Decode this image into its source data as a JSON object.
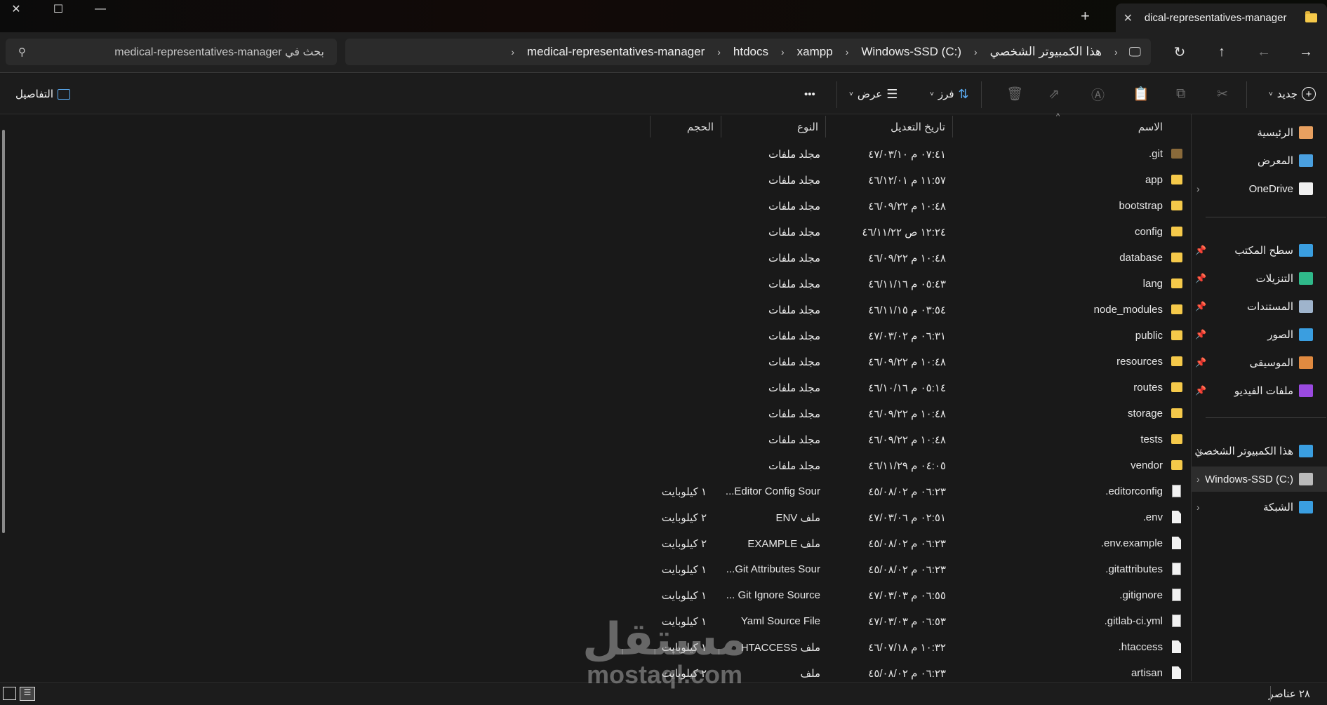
{
  "window": {
    "tab_title": "medical-representatives-manager",
    "new_tab": "+",
    "close": "✕"
  },
  "breadcrumb": [
    "هذا الكمبيوتر الشخصي",
    "Windows-SSD (C:)",
    "xampp",
    "htdocs",
    "medical-representatives-manager"
  ],
  "search": {
    "placeholder": "بحث في medical-representatives-manager"
  },
  "toolbar": {
    "new": "جديد",
    "sort": "فرز",
    "view": "عرض",
    "more": "•••",
    "details": "التفاصيل"
  },
  "columns": {
    "name": "الاسم",
    "date": "تاريخ التعديل",
    "type": "النوع",
    "size": "الحجم"
  },
  "sidebar": {
    "top": [
      {
        "label": "الرئيسية",
        "icon": "home"
      },
      {
        "label": "المعرض",
        "icon": "gallery"
      },
      {
        "label": "OneDrive",
        "icon": "onedrive"
      }
    ],
    "pinned": [
      {
        "label": "سطح المكتب",
        "icon": "desktop"
      },
      {
        "label": "التنزيلات",
        "icon": "downloads"
      },
      {
        "label": "المستندات",
        "icon": "documents"
      },
      {
        "label": "الصور",
        "icon": "pictures"
      },
      {
        "label": "الموسيقى",
        "icon": "music"
      },
      {
        "label": "ملفات الفيديو",
        "icon": "videos"
      }
    ],
    "bottom": [
      {
        "label": "هذا الكمبيوتر الشخصي",
        "icon": "pc"
      },
      {
        "label": "Windows-SSD (C:)",
        "icon": "drive"
      },
      {
        "label": "الشبكة",
        "icon": "network"
      }
    ]
  },
  "files": [
    {
      "name": ".git",
      "date": "٠٧:٤١ م ٤٧/٠٣/١٠",
      "type": "مجلد ملفات",
      "size": "",
      "kind": "git"
    },
    {
      "name": "app",
      "date": "١١:٥٧ م ٤٦/١٢/٠١",
      "type": "مجلد ملفات",
      "size": "",
      "kind": "folder"
    },
    {
      "name": "bootstrap",
      "date": "١٠:٤٨ م ٤٦/٠٩/٢٢",
      "type": "مجلد ملفات",
      "size": "",
      "kind": "folder"
    },
    {
      "name": "config",
      "date": "١٢:٢٤ ص ٤٦/١١/٢٢",
      "type": "مجلد ملفات",
      "size": "",
      "kind": "folder"
    },
    {
      "name": "database",
      "date": "١٠:٤٨ م ٤٦/٠٩/٢٢",
      "type": "مجلد ملفات",
      "size": "",
      "kind": "folder"
    },
    {
      "name": "lang",
      "date": "٠٥:٤٣ م ٤٦/١١/١٦",
      "type": "مجلد ملفات",
      "size": "",
      "kind": "folder"
    },
    {
      "name": "node_modules",
      "date": "٠٣:٥٤ م ٤٦/١١/١٥",
      "type": "مجلد ملفات",
      "size": "",
      "kind": "folder"
    },
    {
      "name": "public",
      "date": "٠٦:٣١ م ٤٧/٠٣/٠٢",
      "type": "مجلد ملفات",
      "size": "",
      "kind": "folder"
    },
    {
      "name": "resources",
      "date": "١٠:٤٨ م ٤٦/٠٩/٢٢",
      "type": "مجلد ملفات",
      "size": "",
      "kind": "folder"
    },
    {
      "name": "routes",
      "date": "٠٥:١٤ م ٤٦/١٠/١٦",
      "type": "مجلد ملفات",
      "size": "",
      "kind": "folder"
    },
    {
      "name": "storage",
      "date": "١٠:٤٨ م ٤٦/٠٩/٢٢",
      "type": "مجلد ملفات",
      "size": "",
      "kind": "folder"
    },
    {
      "name": "tests",
      "date": "١٠:٤٨ م ٤٦/٠٩/٢٢",
      "type": "مجلد ملفات",
      "size": "",
      "kind": "folder"
    },
    {
      "name": "vendor",
      "date": "٠٤:٠٥ م ٤٦/١١/٢٩",
      "type": "مجلد ملفات",
      "size": "",
      "kind": "folder"
    },
    {
      "name": ".editorconfig",
      "date": "٠٦:٢٣ م ٤٥/٠٨/٠٢",
      "type": "Editor Config Sour...",
      "size": "١ كيلوبايت",
      "kind": "cfg"
    },
    {
      "name": ".env",
      "date": "٠٢:٥١ م ٤٧/٠٣/٠٦",
      "type": "ملف ENV",
      "size": "٢ كيلوبايت",
      "kind": "file"
    },
    {
      "name": ".env.example",
      "date": "٠٦:٢٣ م ٤٥/٠٨/٠٢",
      "type": "ملف EXAMPLE",
      "size": "٢ كيلوبايت",
      "kind": "file"
    },
    {
      "name": ".gitattributes",
      "date": "٠٦:٢٣ م ٤٥/٠٨/٠٢",
      "type": "Git Attributes Sour...",
      "size": "١ كيلوبايت",
      "kind": "cfg"
    },
    {
      "name": ".gitignore",
      "date": "٠٦:٥٥ م ٤٧/٠٣/٠٣",
      "type": "Git Ignore Source ...",
      "size": "١ كيلوبايت",
      "kind": "cfg"
    },
    {
      "name": ".gitlab-ci.yml",
      "date": "٠٦:٥٣ م ٤٧/٠٣/٠٣",
      "type": "Yaml Source File",
      "size": "١ كيلوبايت",
      "kind": "cfg"
    },
    {
      "name": ".htaccess",
      "date": "١٠:٣٢ م ٤٦/٠٧/١٨",
      "type": "ملف HTACCESS",
      "size": "١ كيلوبايت",
      "kind": "file"
    },
    {
      "name": "artisan",
      "date": "٠٦:٢٣ م ٤٥/٠٨/٠٢",
      "type": "ملف",
      "size": "٢ كيلوبايت",
      "kind": "file"
    }
  ],
  "status": {
    "count": "٢٨ عناصر"
  },
  "watermark": {
    "ar": "مستقل",
    "en": "mostaql.com"
  }
}
